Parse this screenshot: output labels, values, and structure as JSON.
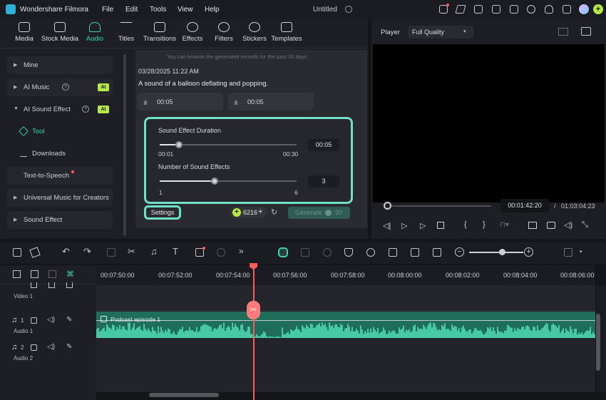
{
  "titlebar": {
    "app_name": "Wondershare Filmora",
    "menu": [
      "File",
      "Edit",
      "Tools",
      "View",
      "Help"
    ],
    "project": "Untitled"
  },
  "media_tabs": [
    {
      "label": "Media",
      "icon": "media-icon",
      "active": false
    },
    {
      "label": "Stock Media",
      "icon": "stock-media-icon",
      "active": false
    },
    {
      "label": "Audio",
      "icon": "music-note-icon",
      "active": true
    },
    {
      "label": "Titles",
      "icon": "titles-icon",
      "active": false
    },
    {
      "label": "Transitions",
      "icon": "transitions-icon",
      "active": false
    },
    {
      "label": "Effects",
      "icon": "effects-icon",
      "active": false
    },
    {
      "label": "Filters",
      "icon": "filters-icon",
      "active": false
    },
    {
      "label": "Stickers",
      "icon": "stickers-icon",
      "active": false
    },
    {
      "label": "Templates",
      "icon": "templates-icon",
      "active": false
    }
  ],
  "sidebar": {
    "mine": "Mine",
    "ai_music": "AI Music",
    "ai_badge": "AI",
    "ai_sound_effect": "AI Sound Effect",
    "tool": "Tool",
    "downloads": "Downloads",
    "text_to_speech": "Text-to-Speech",
    "universal_music": "Universal Music for Creators",
    "sound_effect": "Sound Effect"
  },
  "content": {
    "hint": "You can browse the generated records for the past 30 days.",
    "timestamp": "03/28/2025 11:22 AM",
    "prompt": "A sound of a balloon deflating and popping.",
    "clips": [
      "00:05",
      "00:05"
    ]
  },
  "settings_popup": {
    "duration_label": "Sound Effect Duration",
    "duration_value": "00:05",
    "duration_min": "00:01",
    "duration_max": "00:30",
    "duration_fraction": 0.14,
    "count_label": "Number of Sound Effects",
    "count_value": "3",
    "count_min": "1",
    "count_max": "6",
    "count_fraction": 0.4
  },
  "actions": {
    "settings": "Settings",
    "credits": "6216",
    "generate": "Generate",
    "generate_cost": "30"
  },
  "player": {
    "label": "Player",
    "quality": "Full Quality",
    "current_time": "00:01:42:20",
    "separator": "/",
    "total_time": "01:03:04:23"
  },
  "timeline": {
    "ticks": [
      "00:07:50:00",
      "00:07:52:00",
      "00:07:54:00",
      "00:07:56:00",
      "00:07:58:00",
      "00:08:00:00",
      "00:08:02:00",
      "00:08:04:00",
      "00:08:06:00"
    ],
    "tracks": {
      "video1": "Video 1",
      "audio1": "Audio 1",
      "audio2": "Audio 2",
      "audio1_num": "1",
      "audio2_num": "2"
    },
    "clip_name": "Podcast episode 1"
  },
  "colors": {
    "accent": "#3cd4b0",
    "highlight_border": "#6fe1c9",
    "ai_badge": "#b6e84a",
    "playhead": "#ff5a5a",
    "waveform": "#48c9a5"
  }
}
